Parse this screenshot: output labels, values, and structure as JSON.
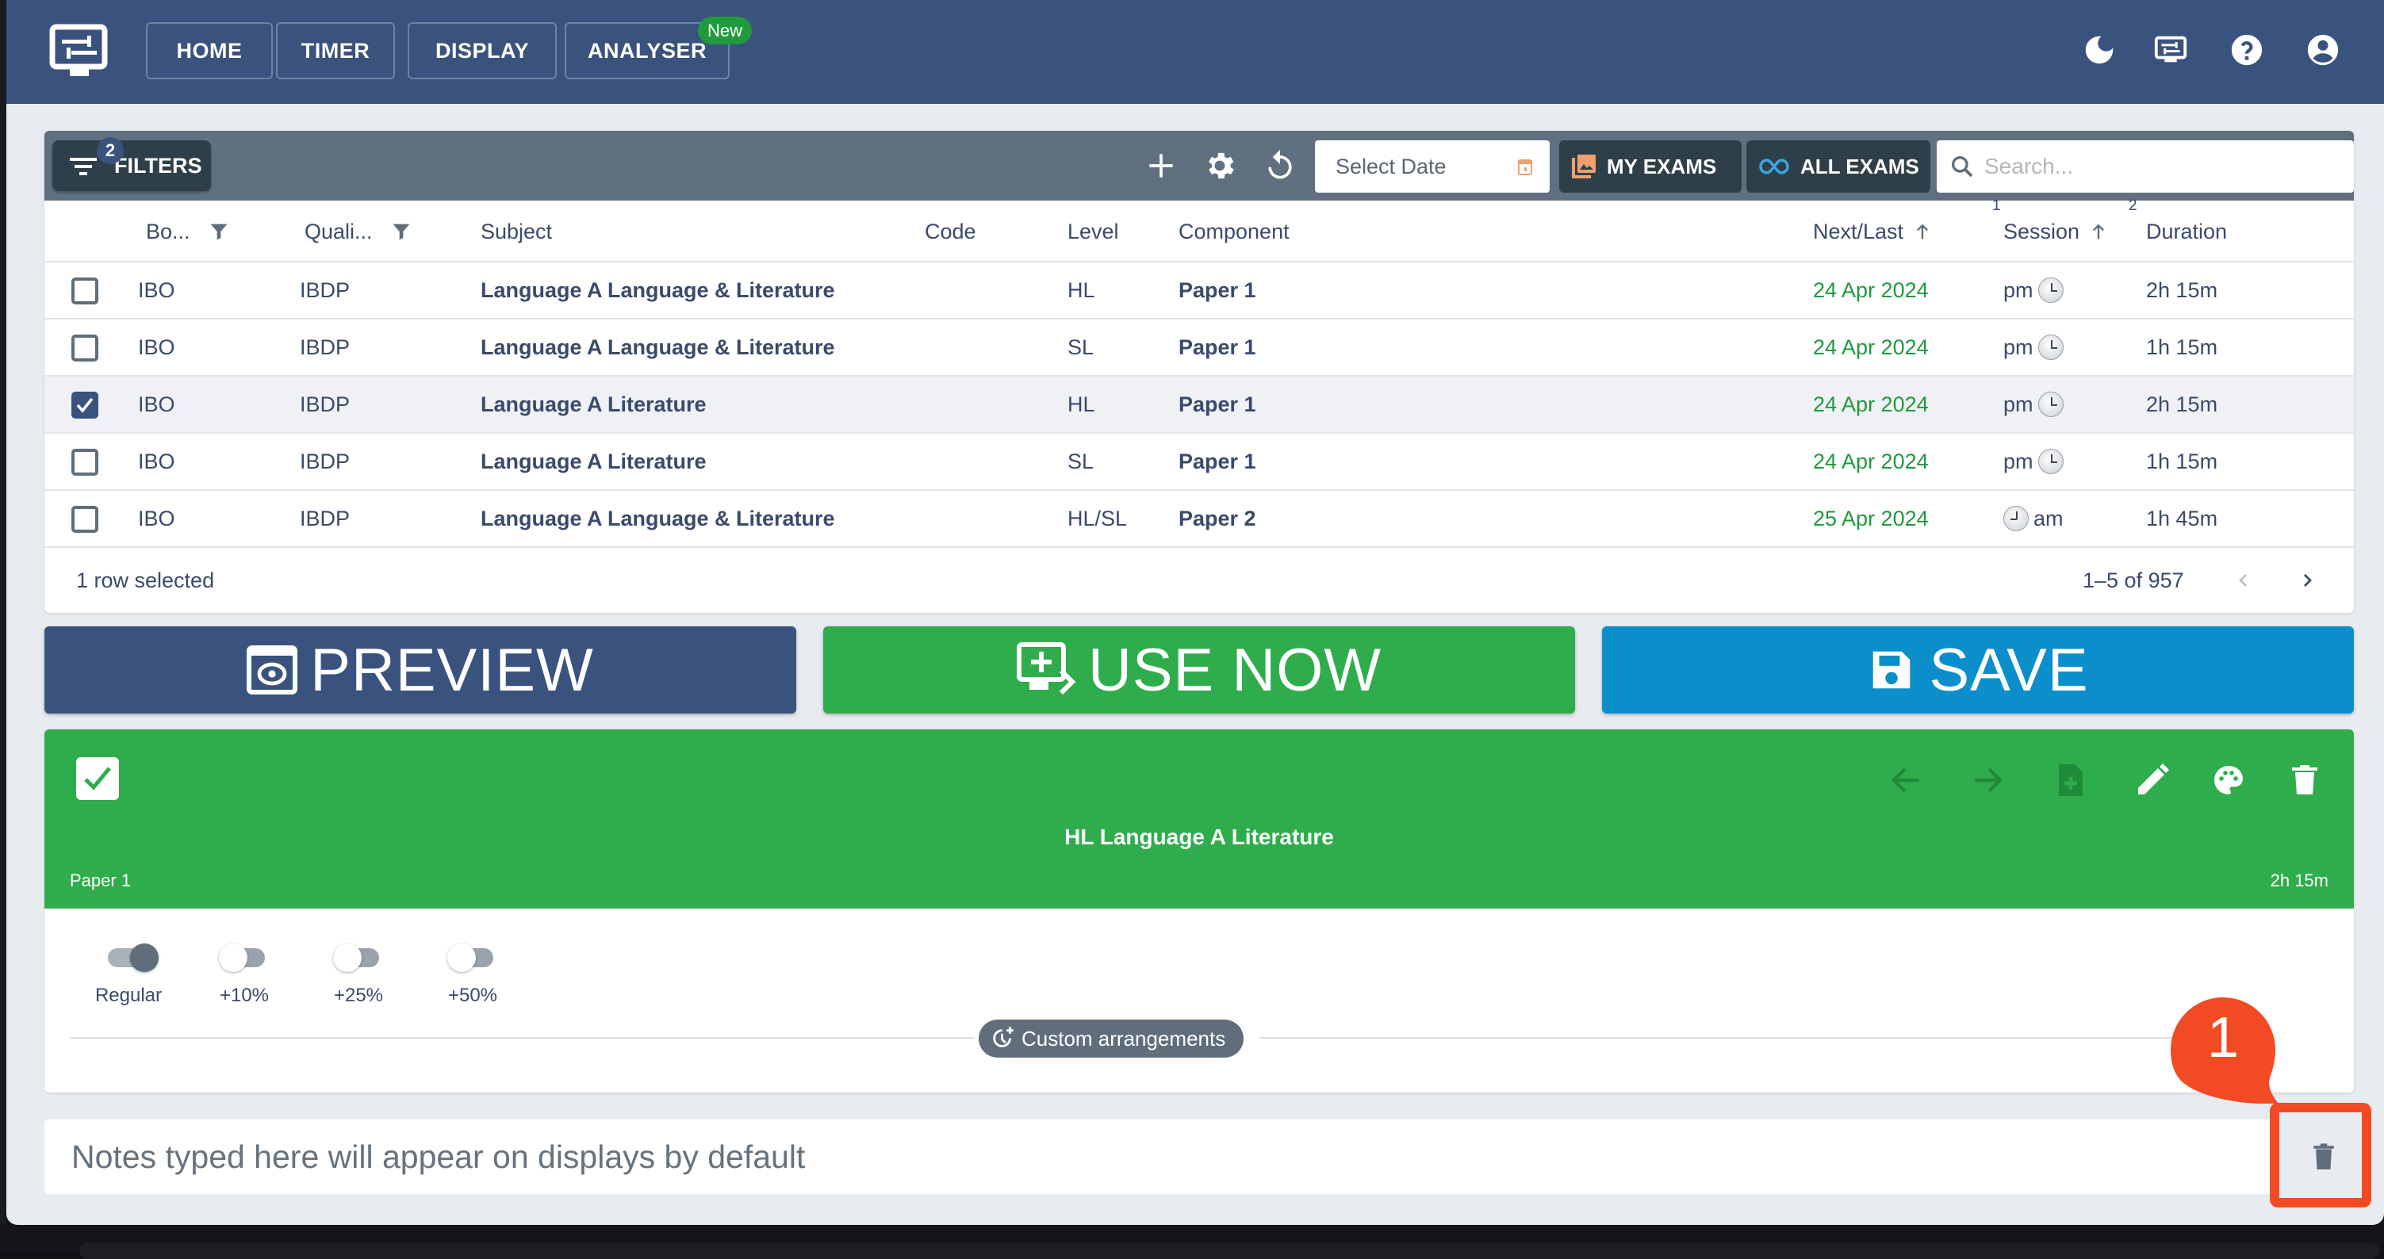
{
  "nav": {
    "items": [
      {
        "label": "HOME"
      },
      {
        "label": "TIMER"
      },
      {
        "label": "DISPLAY"
      },
      {
        "label": "ANALYSER",
        "badge": "New"
      }
    ],
    "right_icons": [
      "moon-icon",
      "display-settings-icon",
      "help-icon",
      "account-icon"
    ]
  },
  "toolbar": {
    "filters_label": "FILTERS",
    "filters_count": "2",
    "date_placeholder": "Select Date",
    "my_exams_label": "MY EXAMS",
    "all_exams_label": "ALL EXAMS",
    "search_placeholder": "Search..."
  },
  "table": {
    "columns": [
      {
        "label": "Bo..."
      },
      {
        "label": "Quali..."
      },
      {
        "label": "Subject"
      },
      {
        "label": "Code"
      },
      {
        "label": "Level"
      },
      {
        "label": "Component"
      },
      {
        "label": "Next/Last",
        "sort_order": "1"
      },
      {
        "label": "Session",
        "sort_order": "2"
      },
      {
        "label": "Duration"
      }
    ],
    "rows": [
      {
        "checked": false,
        "board": "IBO",
        "qual": "IBDP",
        "subject": "Language A Language & Literature",
        "code": "",
        "level": "HL",
        "component": "Paper 1",
        "date": "24 Apr 2024",
        "session": "pm",
        "duration": "2h 15m"
      },
      {
        "checked": false,
        "board": "IBO",
        "qual": "IBDP",
        "subject": "Language A Language & Literature",
        "code": "",
        "level": "SL",
        "component": "Paper 1",
        "date": "24 Apr 2024",
        "session": "pm",
        "duration": "1h 15m"
      },
      {
        "checked": true,
        "board": "IBO",
        "qual": "IBDP",
        "subject": "Language A Literature",
        "code": "",
        "level": "HL",
        "component": "Paper 1",
        "date": "24 Apr 2024",
        "session": "pm",
        "duration": "2h 15m"
      },
      {
        "checked": false,
        "board": "IBO",
        "qual": "IBDP",
        "subject": "Language A Literature",
        "code": "",
        "level": "SL",
        "component": "Paper 1",
        "date": "24 Apr 2024",
        "session": "pm",
        "duration": "1h 15m"
      },
      {
        "checked": false,
        "board": "IBO",
        "qual": "IBDP",
        "subject": "Language A Language & Literature",
        "code": "",
        "level": "HL/SL",
        "component": "Paper 2",
        "date": "25 Apr 2024",
        "session": "am",
        "duration": "1h 45m"
      }
    ],
    "selection_text": "1 row selected",
    "range_text": "1–5 of 957"
  },
  "actions": {
    "preview_label": "PREVIEW",
    "use_now_label": "USE NOW",
    "save_label": "SAVE"
  },
  "exam_card": {
    "title": "HL Language A Literature",
    "paper": "Paper 1",
    "duration": "2h 15m",
    "checked": true,
    "toggles": [
      {
        "label": "Regular",
        "on": true
      },
      {
        "label": "+10%",
        "on": false
      },
      {
        "label": "+25%",
        "on": false
      },
      {
        "label": "+50%",
        "on": false
      }
    ],
    "custom_label": "Custom arrangements"
  },
  "notes": {
    "placeholder": "Notes typed here will appear on displays by default",
    "value": ""
  },
  "annotation": {
    "number": "1"
  },
  "colors": {
    "header": "#3a527e",
    "preview": "#3a527e",
    "use_now": "#2fad4c",
    "save": "#0a8fca",
    "date_text": "#1e9a3d",
    "annotation": "#f24b24"
  }
}
